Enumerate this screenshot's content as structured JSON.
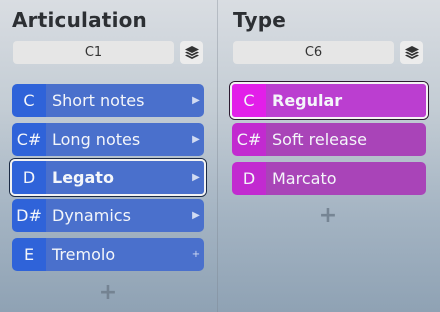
{
  "articulation": {
    "title": "Articulation",
    "key_value": "C1",
    "rows": [
      {
        "key": "C",
        "label": "Short notes",
        "arrow": "▶"
      },
      {
        "key": "C#",
        "label": "Long notes",
        "arrow": "▶"
      },
      {
        "key": "D",
        "label": "Legato",
        "arrow": "▶"
      },
      {
        "key": "D#",
        "label": "Dynamics",
        "arrow": "▶"
      },
      {
        "key": "E",
        "label": "Tremolo",
        "arrow": "+"
      }
    ],
    "selected_index": 2
  },
  "type": {
    "title": "Type",
    "key_value": "C6",
    "rows": [
      {
        "key": "C",
        "label": "Regular"
      },
      {
        "key": "C#",
        "label": "Soft release"
      },
      {
        "key": "D",
        "label": "Marcato"
      }
    ],
    "selected_index": 0
  },
  "add_label": "+",
  "colors": {
    "articulation_key": "#2f63d9",
    "articulation_label": "#4a70cc",
    "type_key": "#c22ad0",
    "type_label": "#a944b8",
    "type_selected_key": "#e21fe9"
  },
  "icons": {
    "stack_button": "layers-icon",
    "row_arrow": "chevron-right-icon",
    "row_plus": "plus-icon",
    "add": "plus-icon"
  }
}
